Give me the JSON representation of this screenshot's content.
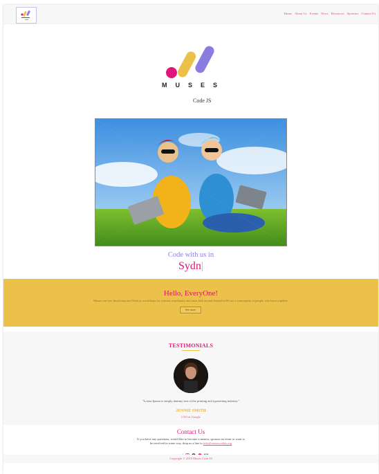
{
  "nav": {
    "items": [
      "Home",
      "About Us",
      "Events",
      "News",
      "Resources",
      "Sponsors",
      "Contact Us"
    ]
  },
  "hero": {
    "logo_word": "MUSES",
    "subtitle": "Code JS",
    "tagline": "Code with us in",
    "city": "Sydn",
    "caret": "|"
  },
  "hello": {
    "title": "Hello, EveryOne!",
    "text": "Muses run free JavaScript and Node.js workshops for women, non-binary and trans folk around Australia.We are a community of people who learn together.",
    "button": "See more"
  },
  "testimonials": {
    "title": "TESTIMONIALS",
    "quote": "\"Lorem Ipsum is simply dummy text of the printing and typesetting industry.\"",
    "name": "JENNIE SMITH",
    "role": "CTO at Google"
  },
  "contact": {
    "title": "Contact Us",
    "line1": "If you have any questions, would like to become a mentor, sponsor an event or want to",
    "line2_prefix": "be involved in some way, drop us a line to ",
    "email": "info@musescodejs.org",
    "icons": [
      "twitter-icon",
      "instagram-icon",
      "github-icon",
      "meetup-icon",
      "mail-icon"
    ]
  },
  "footer": {
    "copyright": "Copyright © 2019 Muses Code JS"
  },
  "colors": {
    "accent_pink": "#e0177a",
    "accent_purple": "#8b7de0",
    "accent_yellow": "#ecc14a"
  }
}
